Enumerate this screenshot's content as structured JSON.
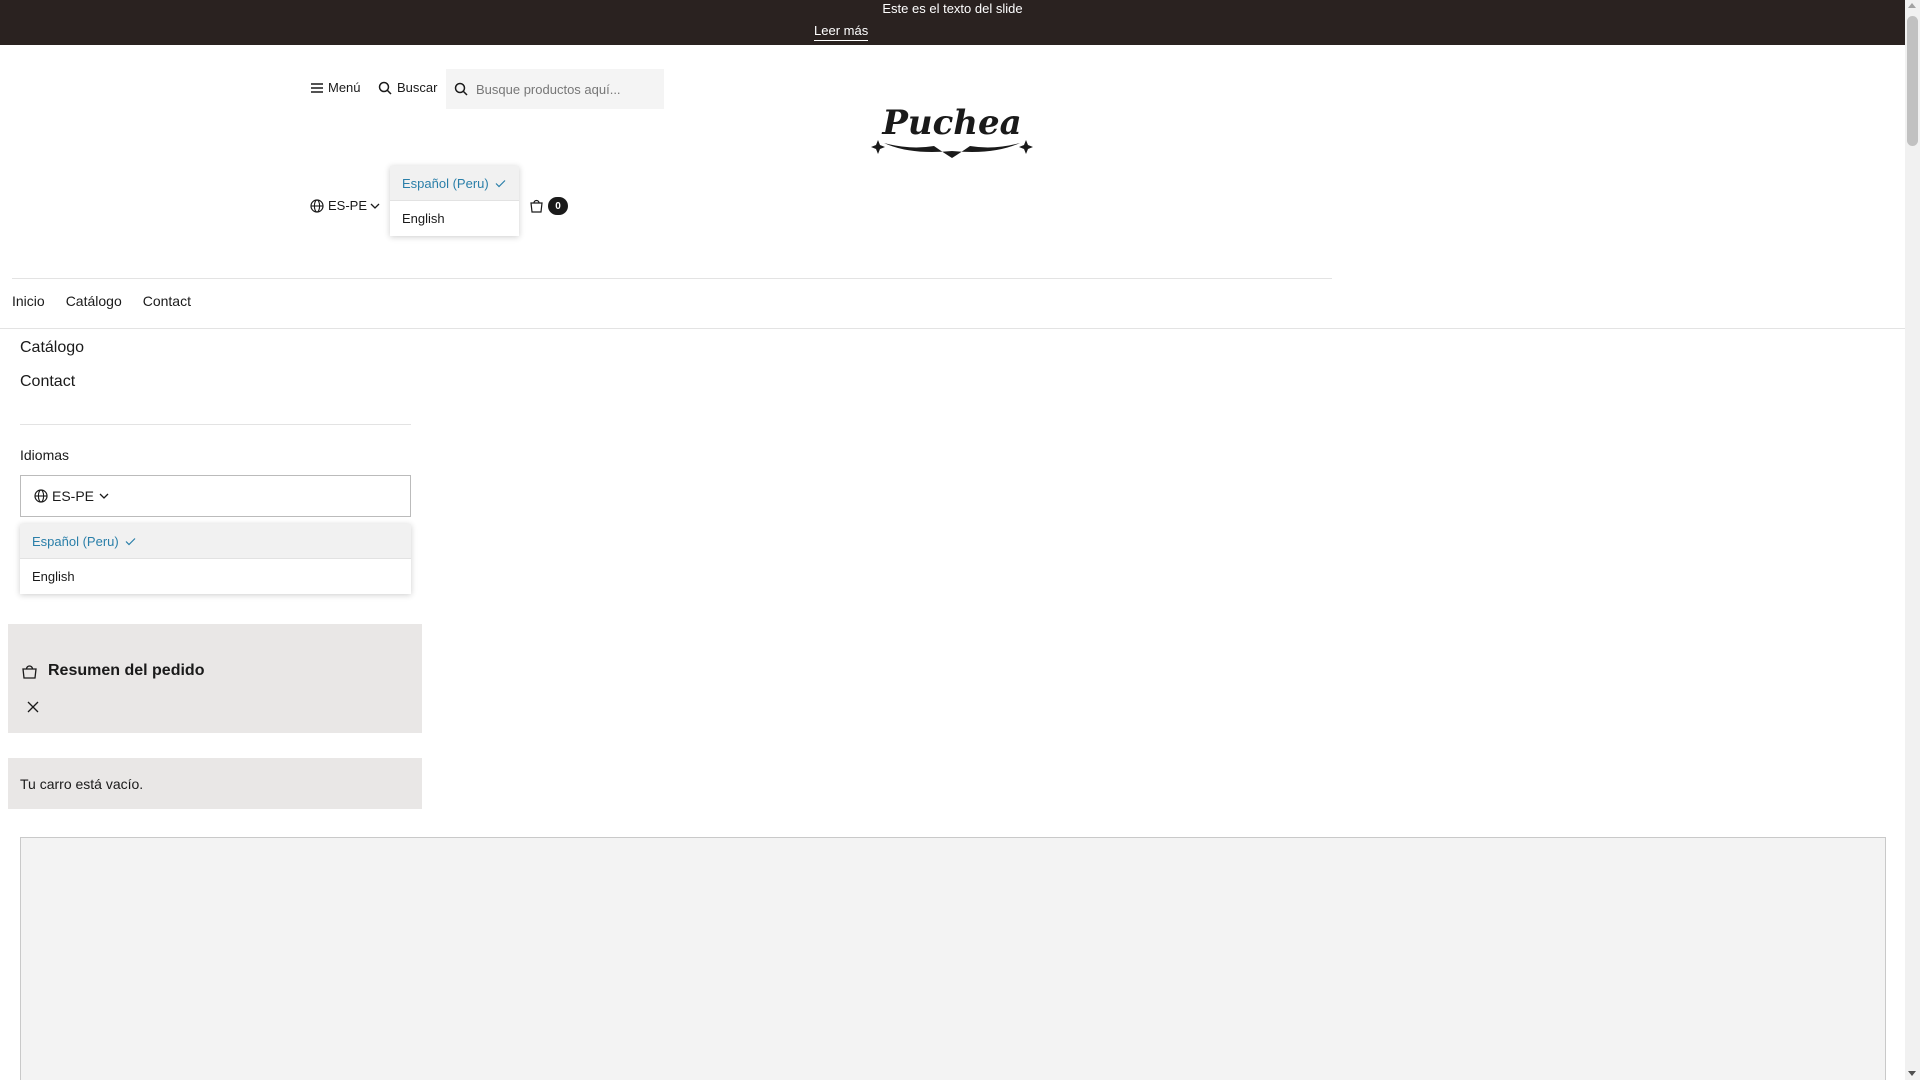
{
  "announcement": {
    "text": "Este es el texto del slide",
    "link": "Leer más"
  },
  "header": {
    "menu_label": "Menú",
    "search_label": "Buscar",
    "search_placeholder": "Busque productos aquí...",
    "logo_text": "Puchea",
    "locale_label": "ES-PE",
    "cart_count": "0"
  },
  "locale_dropdown": {
    "options": [
      {
        "label": "Español (Peru)",
        "selected": true
      },
      {
        "label": "English",
        "selected": false
      }
    ]
  },
  "nav": {
    "items": [
      "Inicio",
      "Catálogo",
      "Contact"
    ]
  },
  "side_menu": {
    "links": [
      "Catálogo",
      "Contact"
    ],
    "languages_title": "Idiomas",
    "language_value": "ES-PE",
    "options": [
      {
        "label": "Español (Peru)",
        "selected": true
      },
      {
        "label": "English",
        "selected": false
      }
    ]
  },
  "cart_panel": {
    "title": "Resumen del pedido",
    "empty_message": "Tu carro está vacío."
  },
  "colors": {
    "announcement_bg": "#2a2220",
    "selected_option": "#2a7fa9",
    "panel_bg": "#e9e7e6"
  }
}
